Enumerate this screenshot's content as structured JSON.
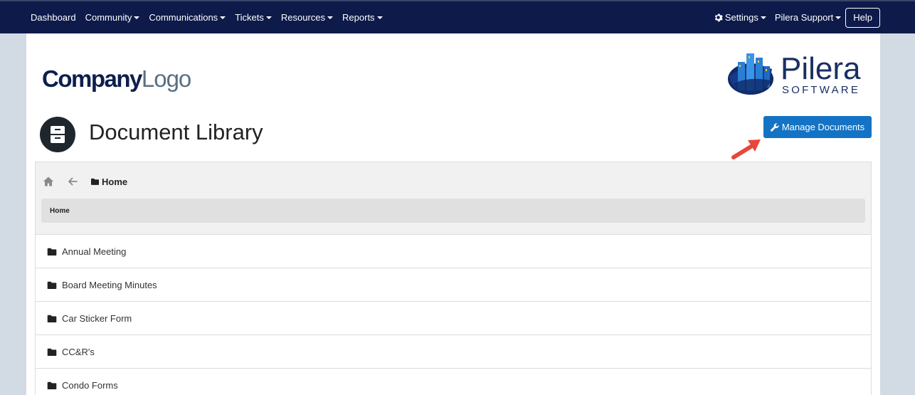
{
  "nav": {
    "left": [
      {
        "label": "Dashboard",
        "dropdown": false
      },
      {
        "label": "Community",
        "dropdown": true
      },
      {
        "label": "Communications",
        "dropdown": true
      },
      {
        "label": "Tickets",
        "dropdown": true
      },
      {
        "label": "Resources",
        "dropdown": true
      },
      {
        "label": "Reports",
        "dropdown": true
      }
    ],
    "settings_label": "Settings",
    "user_label": "Pilera Support",
    "help_label": "Help"
  },
  "branding": {
    "company_text_bold": "Company",
    "company_text_light": "Logo",
    "pilera_word": "Pilera",
    "pilera_sub": "SOFTWARE"
  },
  "page": {
    "title": "Document Library",
    "manage_button": "Manage Documents"
  },
  "library": {
    "current_folder": "Home",
    "breadcrumb": "Home",
    "folders": [
      "Annual Meeting",
      "Board Meeting Minutes",
      "Car Sticker Form",
      "CC&R's",
      "Condo Forms"
    ]
  },
  "colors": {
    "navbar": "#0d1a4a",
    "primary_button": "#1473c4",
    "annotation_arrow": "#e8463a",
    "page_background": "#d2dbe4"
  }
}
